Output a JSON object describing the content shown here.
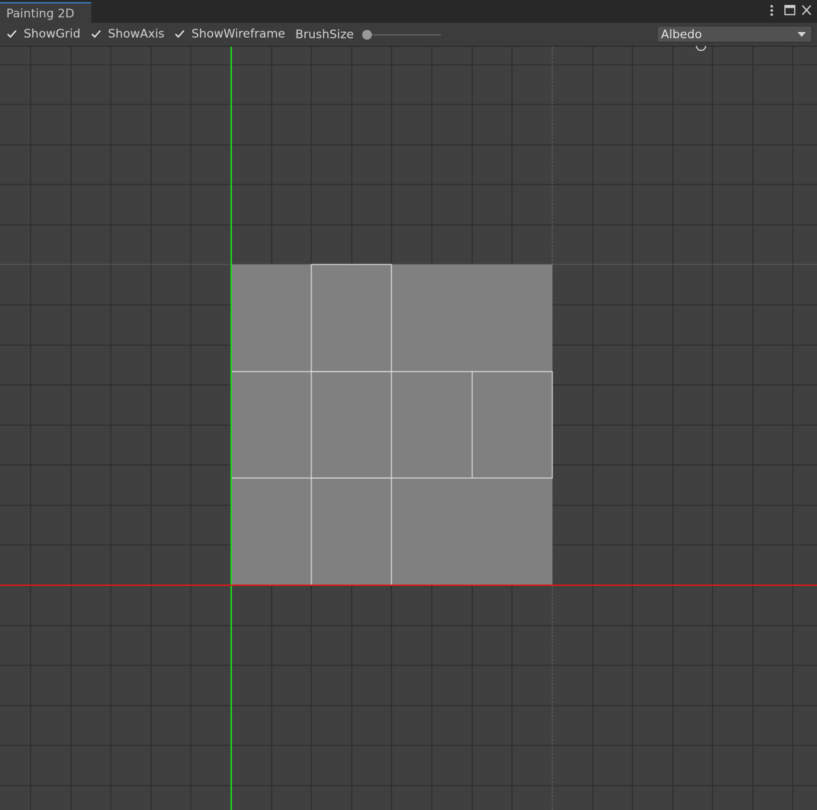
{
  "window": {
    "tab_title": "Painting 2D",
    "controls": {
      "menu_icon": "kebab-menu-icon",
      "maximize_icon": "maximize-icon",
      "close_icon": "close-icon"
    }
  },
  "toolbar": {
    "show_grid": {
      "label": "ShowGrid",
      "checked": true
    },
    "show_axis": {
      "label": "ShowAxis",
      "checked": true
    },
    "show_wireframe": {
      "label": "ShowWireframe",
      "checked": true
    },
    "brush_size": {
      "label": "BrushSize",
      "value": 0
    },
    "channel": {
      "selected": "Albedo"
    }
  },
  "colors": {
    "background": "#404040",
    "grid_line": "#2f2f2f",
    "axis_x": "#e01818",
    "axis_y": "#18e018",
    "texture_fill": "#808080",
    "wireframe": "#e8e8e8",
    "tab_accent": "#3a79bb"
  }
}
